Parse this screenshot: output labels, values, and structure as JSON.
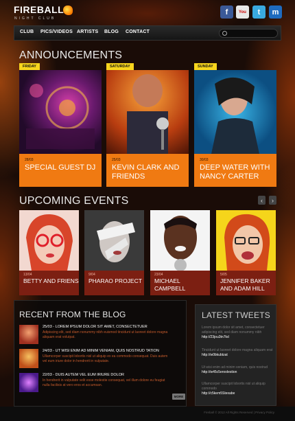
{
  "brand": {
    "name": "FIREBALL",
    "tagline": "NIGHT CLUB"
  },
  "social": [
    {
      "icon": "facebook-icon",
      "glyph": "f"
    },
    {
      "icon": "youtube-icon",
      "glyph": "You"
    },
    {
      "icon": "twitter-icon",
      "glyph": "t"
    },
    {
      "icon": "myspace-icon",
      "glyph": "m"
    }
  ],
  "nav": [
    "CLUB",
    "PICS/VIDEOS",
    "ARTISTS",
    "BLOG",
    "CONTACT"
  ],
  "announcements": {
    "title": "ANNOUNCEMENTS",
    "items": [
      {
        "day": "FRIDAY",
        "date": "28/03",
        "title": "SPECIAL GUEST DJ"
      },
      {
        "day": "SATURDAY",
        "date": "25/03",
        "title": "KEVIN CLARK AND FRIENDS"
      },
      {
        "day": "SUNDAY",
        "date": "30/03",
        "title": "DEEP WATER WITH NANCY CARTER"
      }
    ]
  },
  "events": {
    "title": "UPCOMING EVENTS",
    "items": [
      {
        "date": "13/04",
        "title": "BETTY AND FRIENS"
      },
      {
        "date": "9/04",
        "title": "PHARAO PROJECT"
      },
      {
        "date": "23/04",
        "title": "MICHAEL CAMPBELL"
      },
      {
        "date": "5/05",
        "title": "JENNIFER BAKER AND ADAM HILL"
      }
    ]
  },
  "blog": {
    "title": "RECENT FROM THE BLOG",
    "items": [
      {
        "date": "25/03 - LOREM IPSUM DOLOR SIT AMET, CONSECTETUER",
        "text": [
          "Adipiscing elit, sed diam nonummy nibh euismod tincidunt ut laoreet dolore magna",
          "aliquam erat volutpat."
        ]
      },
      {
        "date": "24/03 - UT WISI ENIM AD MINIM VENIAM, QUIS NOSTRUD TATION",
        "text": [
          "Ullamcorper suscipit lobortis nisl ut aliquip ex ea commodo consequat. Duis autem",
          "vel eum iriure dolor in hendrerit in vulputate."
        ]
      },
      {
        "date": "22/03 - DUIS AUTEM VEL EUM IRIURE DOLOR",
        "text": [
          "In hendrerit in vulputate velit esse molestie consequat, vel illum dolore eu feugiat",
          "nulla facilisis at vero eros et accumsan."
        ]
      }
    ],
    "more_label": "MORE"
  },
  "tweets": {
    "title": "LATEST TWEETS",
    "items": [
      {
        "text": "Lorem ipsum dolor sit amet, consectetuer adipiscing elit, sed diam nonummy nibh",
        "link": "http://23jou3tn7kd"
      },
      {
        "text": "Tincidunt ut laoreet dolore magna aliquam erat",
        "link": "http://w0bkubtzat"
      },
      {
        "text": "Ut wisi enim ad minim veniam, quis nostrud",
        "link": "http://w45c5eroolestion"
      },
      {
        "text": "Ullamcorper suscipit lobortis nisl ut aliquip commodo",
        "link": "http://c5kem5Stexabe"
      }
    ]
  },
  "footer": {
    "text": "Fireball © 2012 All Rights Reserved  |  Privacy Policy"
  },
  "colors": {
    "orange": "#f07a12",
    "dark_red": "#7c1f12",
    "yellow_tag": "#f7d51d"
  }
}
